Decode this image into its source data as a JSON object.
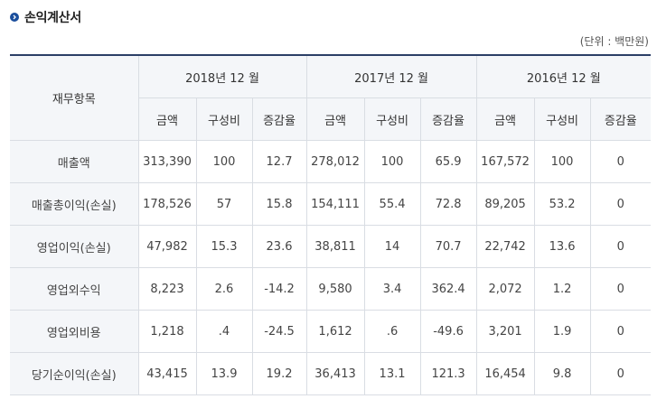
{
  "title": "손익계산서",
  "unit_label": "(단위 : 백만원)",
  "table": {
    "item_header": "재무항목",
    "periods": [
      "2018년 12 월",
      "2017년 12 월",
      "2016년 12 월"
    ],
    "sub_headers": [
      "금액",
      "구성비",
      "증감율"
    ],
    "rows": [
      {
        "label": "매출액",
        "cells": [
          "313,390",
          "100",
          "12.7",
          "278,012",
          "100",
          "65.9",
          "167,572",
          "100",
          "0"
        ]
      },
      {
        "label": "매출총이익(손실)",
        "cells": [
          "178,526",
          "57",
          "15.8",
          "154,111",
          "55.4",
          "72.8",
          "89,205",
          "53.2",
          "0"
        ]
      },
      {
        "label": "영업이익(손실)",
        "cells": [
          "47,982",
          "15.3",
          "23.6",
          "38,811",
          "14",
          "70.7",
          "22,742",
          "13.6",
          "0"
        ]
      },
      {
        "label": "영업외수익",
        "cells": [
          "8,223",
          "2.6",
          "-14.2",
          "9,580",
          "3.4",
          "362.4",
          "2,072",
          "1.2",
          "0"
        ]
      },
      {
        "label": "영업외비용",
        "cells": [
          "1,218",
          ".4",
          "-24.5",
          "1,612",
          ".6",
          "-49.6",
          "3,201",
          "1.9",
          "0"
        ]
      },
      {
        "label": "당기순이익(손실)",
        "cells": [
          "43,415",
          "13.9",
          "19.2",
          "36,413",
          "13.1",
          "121.3",
          "16,454",
          "9.8",
          "0"
        ]
      }
    ]
  },
  "colors": {
    "accent": "#1a4e9c",
    "header_border": "#2b3f66",
    "header_bg": "#f4f6f9",
    "grid": "#d9dde3"
  },
  "icons": {
    "title_bullet": "chevron-right-icon"
  }
}
